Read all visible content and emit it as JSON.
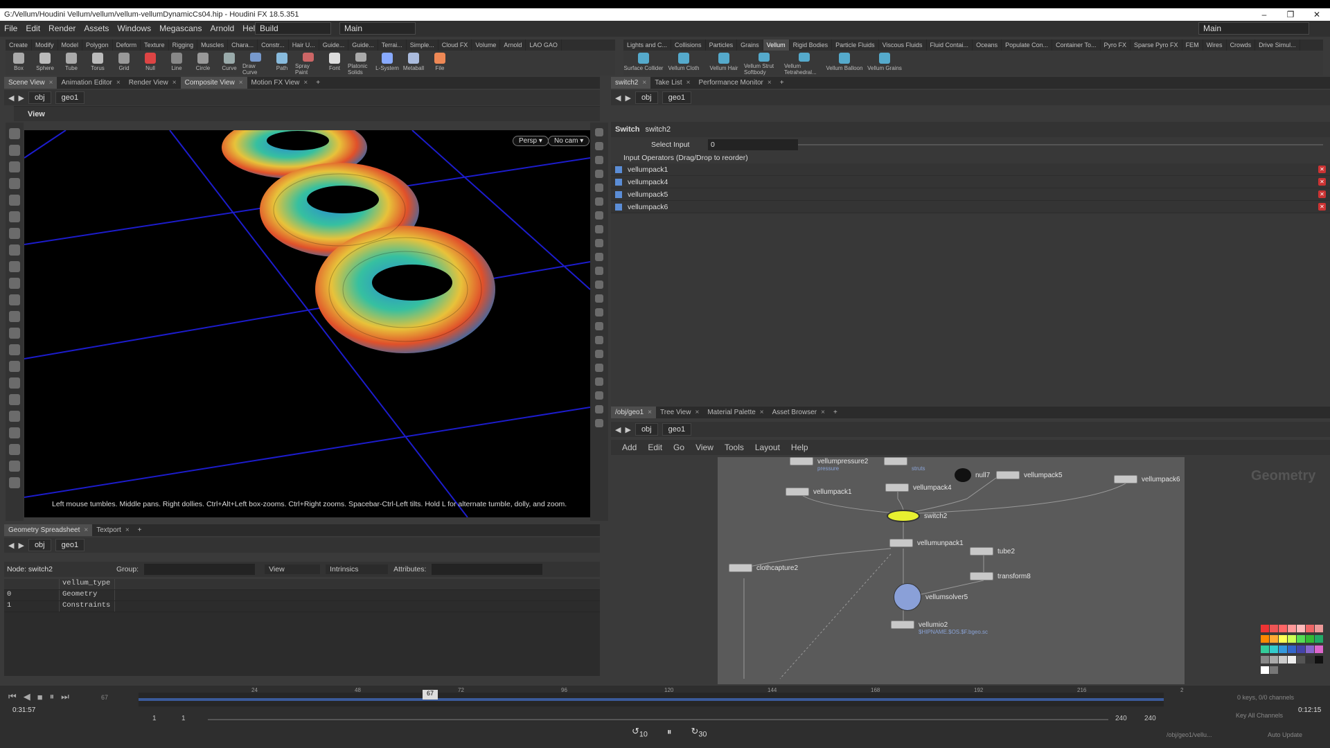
{
  "window": {
    "title": "G:/Vellum/Houdini Vellum/vellum/vellum-vellumDynamicCs04.hip - Houdini FX 18.5.351",
    "controls": [
      "–",
      "❐",
      "✕"
    ]
  },
  "menu": {
    "items": [
      "File",
      "Edit",
      "Render",
      "Assets",
      "Windows",
      "Megascans",
      "Arnold",
      "Help"
    ],
    "desktop_left": "Build",
    "desktop_right": "Main",
    "desktop_far_right": "Main"
  },
  "shelf_left": {
    "tabs": [
      "Create",
      "Modify",
      "Model",
      "Polygon",
      "Deform",
      "Texture",
      "Rigging",
      "Muscles",
      "Chara...",
      "Constr...",
      "Hair U...",
      "Guide...",
      "Guide...",
      "Terrai...",
      "Simple...",
      "Cloud FX",
      "Volume",
      "Arnold",
      "LAO GAO"
    ],
    "tools": [
      "Box",
      "Sphere",
      "Tube",
      "Torus",
      "Grid",
      "Null",
      "Line",
      "Circle",
      "Curve",
      "Draw Curve",
      "Path",
      "Spray Paint",
      "Font",
      "Platonic Solids",
      "L-System",
      "Metaball",
      "File"
    ]
  },
  "shelf_right": {
    "tabs": [
      "Lights and C...",
      "Collisions",
      "Particles",
      "Grains",
      "Vellum",
      "Rigid Bodies",
      "Particle Fluids",
      "Viscous Fluids",
      "Fluid Contai...",
      "Oceans",
      "Populate Con...",
      "Container To...",
      "Pyro FX",
      "Sparse Pyro FX",
      "FEM",
      "Wires",
      "Crowds",
      "Drive Simul..."
    ],
    "active_tab": "Vellum",
    "tools": [
      "Surface Collider",
      "Vellum Cloth",
      "Vellum Hair",
      "Vellum Strut Softbody",
      "Vellum Tetrahedral...",
      "Vellum Balloon",
      "Vellum Grains"
    ]
  },
  "scene_panel": {
    "tabs": [
      "Scene View",
      "Animation Editor",
      "Render View",
      "Composite View",
      "Motion FX View"
    ],
    "path": [
      "obj",
      "geo1"
    ],
    "view_label": "View",
    "persp": "Persp ▾",
    "cam": "No cam ▾",
    "help": "Left mouse tumbles. Middle pans. Right dollies. Ctrl+Alt+Left box-zooms. Ctrl+Right zooms. Spacebar-Ctrl-Left tilts. Hold L for alternate tumble, dolly, and zoom."
  },
  "param_panel": {
    "tabs": [
      "switch2",
      "Take List",
      "Performance Monitor"
    ],
    "path": [
      "obj",
      "geo1"
    ],
    "node_type": "Switch",
    "node_name": "switch2",
    "select_input_label": "Select Input",
    "select_input_value": "0",
    "inputs_header": "Input Operators (Drag/Drop to reorder)",
    "inputs": [
      "vellumpack1",
      "vellumpack4",
      "vellumpack5",
      "vellumpack6"
    ]
  },
  "spreadsheet": {
    "tabs": [
      "Geometry Spreadsheet",
      "Textport"
    ],
    "path": [
      "obj",
      "geo1"
    ],
    "node_label": "Node: switch2",
    "group_label": "Group:",
    "view_label": "View",
    "intrinsics_label": "Intrinsics",
    "attributes_label": "Attributes:",
    "column": "vellum_type",
    "rows": [
      {
        "idx": "0",
        "val": "Geometry"
      },
      {
        "idx": "1",
        "val": "Constraints"
      }
    ]
  },
  "network": {
    "tabs": [
      "/obj/geo1",
      "Tree View",
      "Material Palette",
      "Asset Browser"
    ],
    "path": [
      "obj",
      "geo1"
    ],
    "menu": [
      "Add",
      "Edit",
      "Go",
      "View",
      "Tools",
      "Layout",
      "Help"
    ],
    "context_label": "Geometry",
    "nodes": {
      "vellumpressure2": "vellumpressure2",
      "pressure": "pressure",
      "struts": "struts",
      "vellumpack1": "vellumpack1",
      "vellumpack4": "vellumpack4",
      "null7": "null7",
      "vellumpack5": "vellumpack5",
      "vellumpack6": "vellumpack6",
      "switch2": "switch2",
      "vellumunpack1": "vellumunpack1",
      "tube2": "tube2",
      "transform8": "transform8",
      "clothcapture2": "clothcapture2",
      "vellumsolver5": "vellumsolver5",
      "vellumio2": "vellumio2",
      "vellumio2_sub": "$HIPNAME.$OS.$F.bgeo.sc"
    }
  },
  "timeline": {
    "ticks": [
      "24",
      "48",
      "72",
      "96",
      "120",
      "144",
      "168",
      "192",
      "216",
      "2"
    ],
    "current_frame": "67",
    "start": "1",
    "start2": "1",
    "end": "240",
    "end2": "240",
    "time_left": "0:31:57",
    "time_right": "0:12:15",
    "keys": "0 keys, 0/0 channels",
    "key_all": "Key All Channels",
    "status_path": "/obj/geo1/vellu...",
    "auto_update": "Auto Update",
    "rewind": "10",
    "forward": "30",
    "frame_prev": "67"
  }
}
